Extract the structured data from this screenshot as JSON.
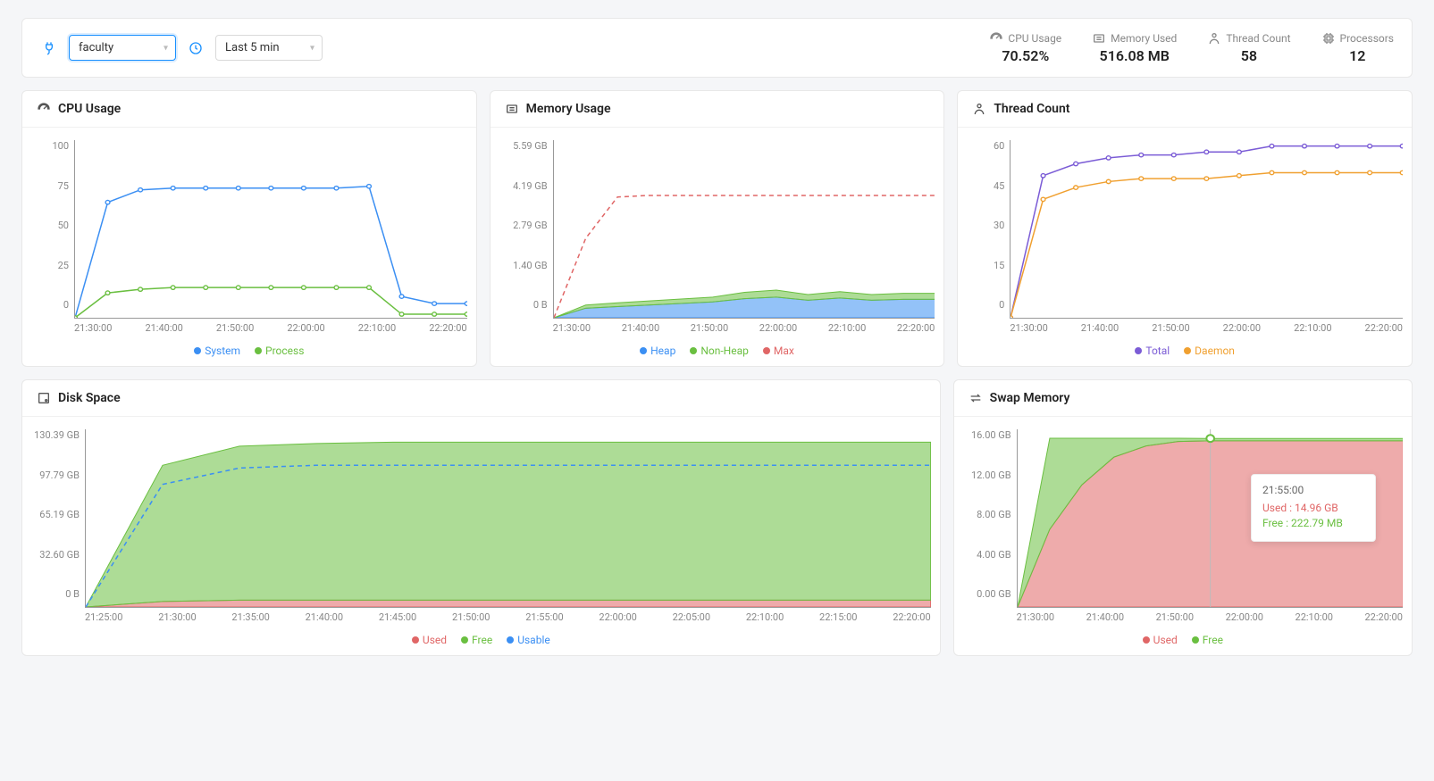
{
  "header": {
    "service_select": "faculty",
    "time_select": "Last 5 min",
    "metrics": {
      "cpu_label": "CPU Usage",
      "cpu_value": "70.52%",
      "memory_label": "Memory Used",
      "memory_value": "516.08 MB",
      "thread_label": "Thread Count",
      "thread_value": "58",
      "processors_label": "Processors",
      "processors_value": "12"
    }
  },
  "cards": {
    "cpu": {
      "title": "CPU Usage"
    },
    "memory": {
      "title": "Memory Usage"
    },
    "thread": {
      "title": "Thread Count"
    },
    "disk": {
      "title": "Disk Space"
    },
    "swap": {
      "title": "Swap Memory"
    }
  },
  "legends": {
    "cpu": {
      "system": "System",
      "process": "Process"
    },
    "memory": {
      "heap": "Heap",
      "nonheap": "Non-Heap",
      "max": "Max"
    },
    "thread": {
      "total": "Total",
      "daemon": "Daemon"
    },
    "disk": {
      "used": "Used",
      "free": "Free",
      "usable": "Usable"
    },
    "swap": {
      "used": "Used",
      "free": "Free"
    }
  },
  "colors": {
    "blue": "#3b8ff3",
    "green": "#6abf40",
    "green_fill": "#8ed160",
    "red": "#e06666",
    "red_fill": "#e28b85",
    "purple": "#7b5cd6",
    "orange": "#f0a030"
  },
  "tooltip": {
    "time": "21:55:00",
    "used_label": "Used : 14.96 GB",
    "free_label": "Free : 222.79 MB"
  },
  "chart_data": [
    {
      "id": "cpu",
      "type": "line",
      "title": "CPU Usage",
      "xlabel": "",
      "ylabel": "",
      "ylim": [
        0,
        100
      ],
      "y_ticks": [
        0,
        25,
        50,
        75,
        100
      ],
      "x": [
        "21:30:00",
        "21:40:00",
        "21:50:00",
        "22:00:00",
        "22:10:00",
        "22:20:00"
      ],
      "series": [
        {
          "name": "System",
          "color": "#3b8ff3",
          "values": [
            0,
            65,
            72,
            73,
            73,
            73,
            73,
            73,
            73,
            74,
            12,
            8,
            8
          ]
        },
        {
          "name": "Process",
          "color": "#6abf40",
          "values": [
            0,
            14,
            16,
            17,
            17,
            17,
            17,
            17,
            17,
            17,
            2,
            2,
            2
          ]
        }
      ]
    },
    {
      "id": "memory",
      "type": "area",
      "title": "Memory Usage",
      "ylim": [
        0,
        5.59
      ],
      "y_ticks_labels": [
        "0 B",
        "1.40 GB",
        "2.79 GB",
        "4.19 GB",
        "5.59 GB"
      ],
      "x": [
        "21:30:00",
        "21:40:00",
        "21:50:00",
        "22:00:00",
        "22:10:00",
        "22:20:00"
      ],
      "series": [
        {
          "name": "Heap",
          "color": "#3b8ff3",
          "fill": true,
          "values": [
            0,
            0.3,
            0.35,
            0.4,
            0.45,
            0.5,
            0.6,
            0.65,
            0.55,
            0.62,
            0.55,
            0.58,
            0.58
          ]
        },
        {
          "name": "Non-Heap",
          "color": "#6abf40",
          "fill": true,
          "values": [
            0,
            0.1,
            0.12,
            0.13,
            0.14,
            0.15,
            0.2,
            0.22,
            0.18,
            0.2,
            0.18,
            0.19,
            0.19
          ]
        },
        {
          "name": "Max",
          "color": "#e06666",
          "dashed": true,
          "values": [
            0,
            2.5,
            3.8,
            3.85,
            3.85,
            3.85,
            3.85,
            3.85,
            3.85,
            3.85,
            3.85,
            3.85,
            3.85
          ]
        }
      ]
    },
    {
      "id": "thread",
      "type": "line",
      "title": "Thread Count",
      "ylim": [
        0,
        60
      ],
      "y_ticks": [
        0,
        15,
        30,
        45,
        60
      ],
      "x": [
        "21:30:00",
        "21:40:00",
        "21:50:00",
        "22:00:00",
        "22:10:00",
        "22:20:00"
      ],
      "series": [
        {
          "name": "Total",
          "color": "#7b5cd6",
          "values": [
            0,
            48,
            52,
            54,
            55,
            55,
            56,
            56,
            58,
            58,
            58,
            58,
            58
          ]
        },
        {
          "name": "Daemon",
          "color": "#f0a030",
          "values": [
            0,
            40,
            44,
            46,
            47,
            47,
            47,
            48,
            49,
            49,
            49,
            49,
            49
          ]
        }
      ]
    },
    {
      "id": "disk",
      "type": "area",
      "title": "Disk Space",
      "ylim": [
        0,
        130.39
      ],
      "y_ticks_labels": [
        "0 B",
        "32.60 GB",
        "65.19 GB",
        "97.79 GB",
        "130.39 GB"
      ],
      "x": [
        "21:25:00",
        "21:30:00",
        "21:35:00",
        "21:40:00",
        "21:45:00",
        "21:50:00",
        "21:55:00",
        "22:00:00",
        "22:05:00",
        "22:10:00",
        "22:15:00",
        "22:20:00"
      ],
      "series": [
        {
          "name": "Used",
          "color": "#e06666",
          "fill": true,
          "values": [
            0,
            4,
            5,
            5,
            5,
            5,
            5,
            5,
            5,
            5,
            5,
            5
          ]
        },
        {
          "name": "Free",
          "color": "#6abf40",
          "fill": true,
          "values": [
            0,
            100,
            113,
            115,
            116,
            116,
            116,
            116,
            116,
            116,
            116,
            116
          ]
        },
        {
          "name": "Usable",
          "color": "#3b8ff3",
          "dashed": true,
          "values": [
            0,
            90,
            102,
            104,
            104,
            104,
            104,
            104,
            104,
            104,
            104,
            104
          ]
        }
      ]
    },
    {
      "id": "swap",
      "type": "area",
      "title": "Swap Memory",
      "ylim": [
        0,
        16
      ],
      "y_ticks_labels": [
        "0.00 GB",
        "4.00 GB",
        "8.00 GB",
        "12.00 GB",
        "16.00 GB"
      ],
      "x": [
        "21:30:00",
        "21:40:00",
        "21:50:00",
        "22:00:00",
        "22:10:00",
        "22:20:00"
      ],
      "series": [
        {
          "name": "Used",
          "color": "#e06666",
          "fill": true,
          "values": [
            0,
            7,
            11,
            13.5,
            14.5,
            14.9,
            14.96,
            14.96,
            14.96,
            14.96,
            14.96,
            14.96,
            14.96
          ]
        },
        {
          "name": "Free",
          "color": "#6abf40",
          "fill": true,
          "values": [
            0,
            8.2,
            4.2,
            1.7,
            0.7,
            0.3,
            0.22,
            0.22,
            0.22,
            0.22,
            0.22,
            0.22,
            0.22
          ]
        }
      ],
      "tooltip_at": "21:55:00",
      "tooltip_used": "14.96 GB",
      "tooltip_free": "222.79 MB"
    }
  ]
}
